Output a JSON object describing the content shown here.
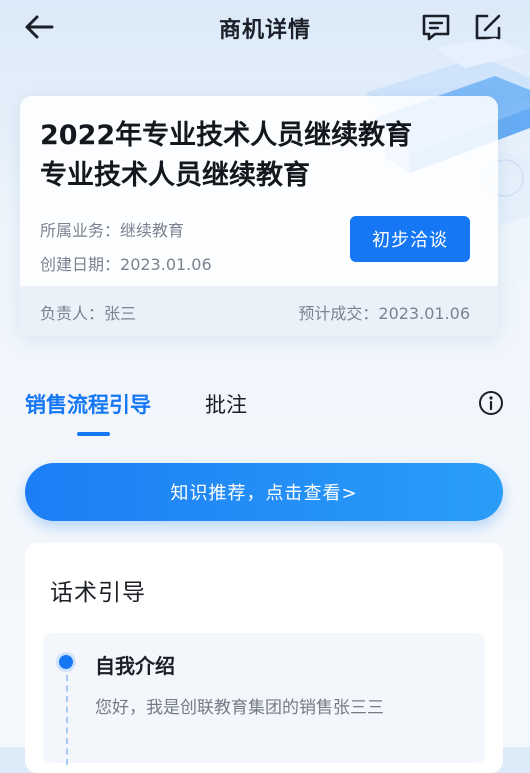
{
  "header": {
    "title": "商机详情"
  },
  "opportunity": {
    "title_line1": "2022年专业技术人员继续教育",
    "title_line2": "专业技术人员继续教育",
    "business_label": "所属业务：",
    "business_value": "继续教育",
    "created_label": "创建日期：",
    "created_value": "2023.01.06",
    "stage_button": "初步洽谈",
    "owner_label": "负责人：",
    "owner_value": "张三",
    "deal_label": "预计成交：",
    "deal_value": "2023.01.06"
  },
  "tabs": [
    {
      "label": "销售流程引导",
      "active": true
    },
    {
      "label": "批注",
      "active": false
    }
  ],
  "knowledge_button": "知识推荐，点击查看>",
  "script_guide": {
    "title": "话术引导",
    "steps": [
      {
        "title": "自我介绍",
        "text": "您好，我是创联教育集团的销售张三三"
      }
    ]
  },
  "colors": {
    "accent": "#1677f5"
  }
}
